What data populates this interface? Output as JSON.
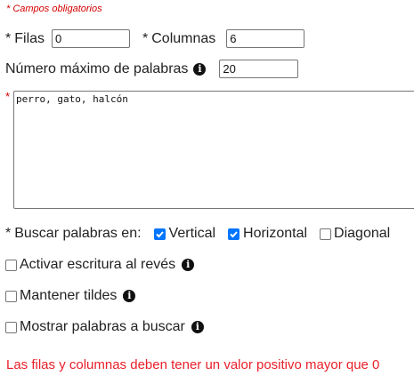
{
  "required_note": "* Campos obligatorios",
  "asterisk": "*",
  "rows": {
    "label": "Filas",
    "value": "0"
  },
  "columns": {
    "label": "Columnas",
    "value": "6"
  },
  "max_words": {
    "label": "Número máximo de palabras",
    "value": "20"
  },
  "words": {
    "value": "perro, gato, halcón"
  },
  "search": {
    "label": "Buscar palabras en:",
    "options": [
      {
        "label": "Vertical",
        "checked": true
      },
      {
        "label": "Horizontal",
        "checked": true
      },
      {
        "label": "Diagonal",
        "checked": false
      }
    ]
  },
  "reverse": {
    "label": "Activar escritura al revés",
    "checked": false
  },
  "accents": {
    "label": "Mantener tildes",
    "checked": false
  },
  "show_words": {
    "label": "Mostrar palabras a buscar",
    "checked": false
  },
  "error_message": "Las filas y columnas deben tener un valor positivo mayor que 0",
  "icons": {
    "info": "info-icon",
    "check": "check-icon"
  },
  "colors": {
    "accent": "#0075ff",
    "required": "#d40000",
    "error": "#e8202a"
  }
}
